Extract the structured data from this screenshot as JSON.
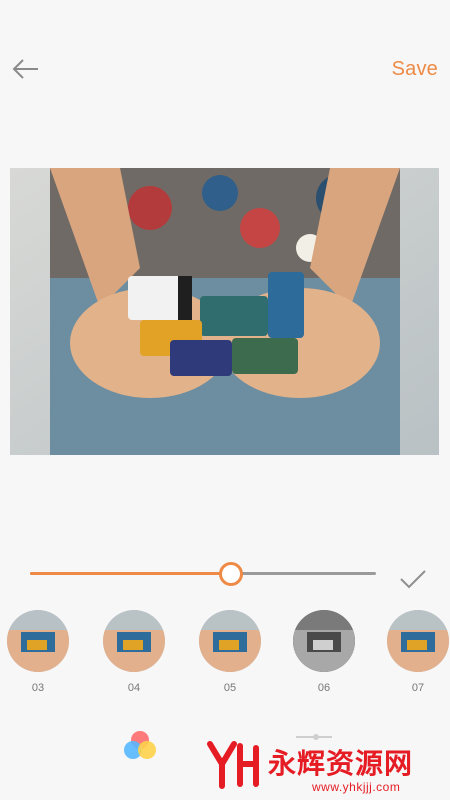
{
  "header": {
    "back_icon": "arrow-left-icon",
    "save_label": "Save",
    "accent_color": "#ee8a45"
  },
  "photo": {
    "description_icon": "photo-preview"
  },
  "slider": {
    "value_fraction": 0.58
  },
  "confirm": {
    "icon": "checkmark-icon"
  },
  "filters": [
    {
      "label": "03",
      "selected": false
    },
    {
      "label": "04",
      "selected": false
    },
    {
      "label": "05",
      "selected": false
    },
    {
      "label": "06",
      "selected": true
    },
    {
      "label": "07",
      "selected": false
    }
  ],
  "bottombar": {
    "color_icon": "color-dots-icon",
    "adjust_icon": "adjust-slider-icon"
  },
  "watermark": {
    "title": "永辉资源网",
    "url": "www.yhkjjj.com",
    "color": "#e61c24"
  }
}
